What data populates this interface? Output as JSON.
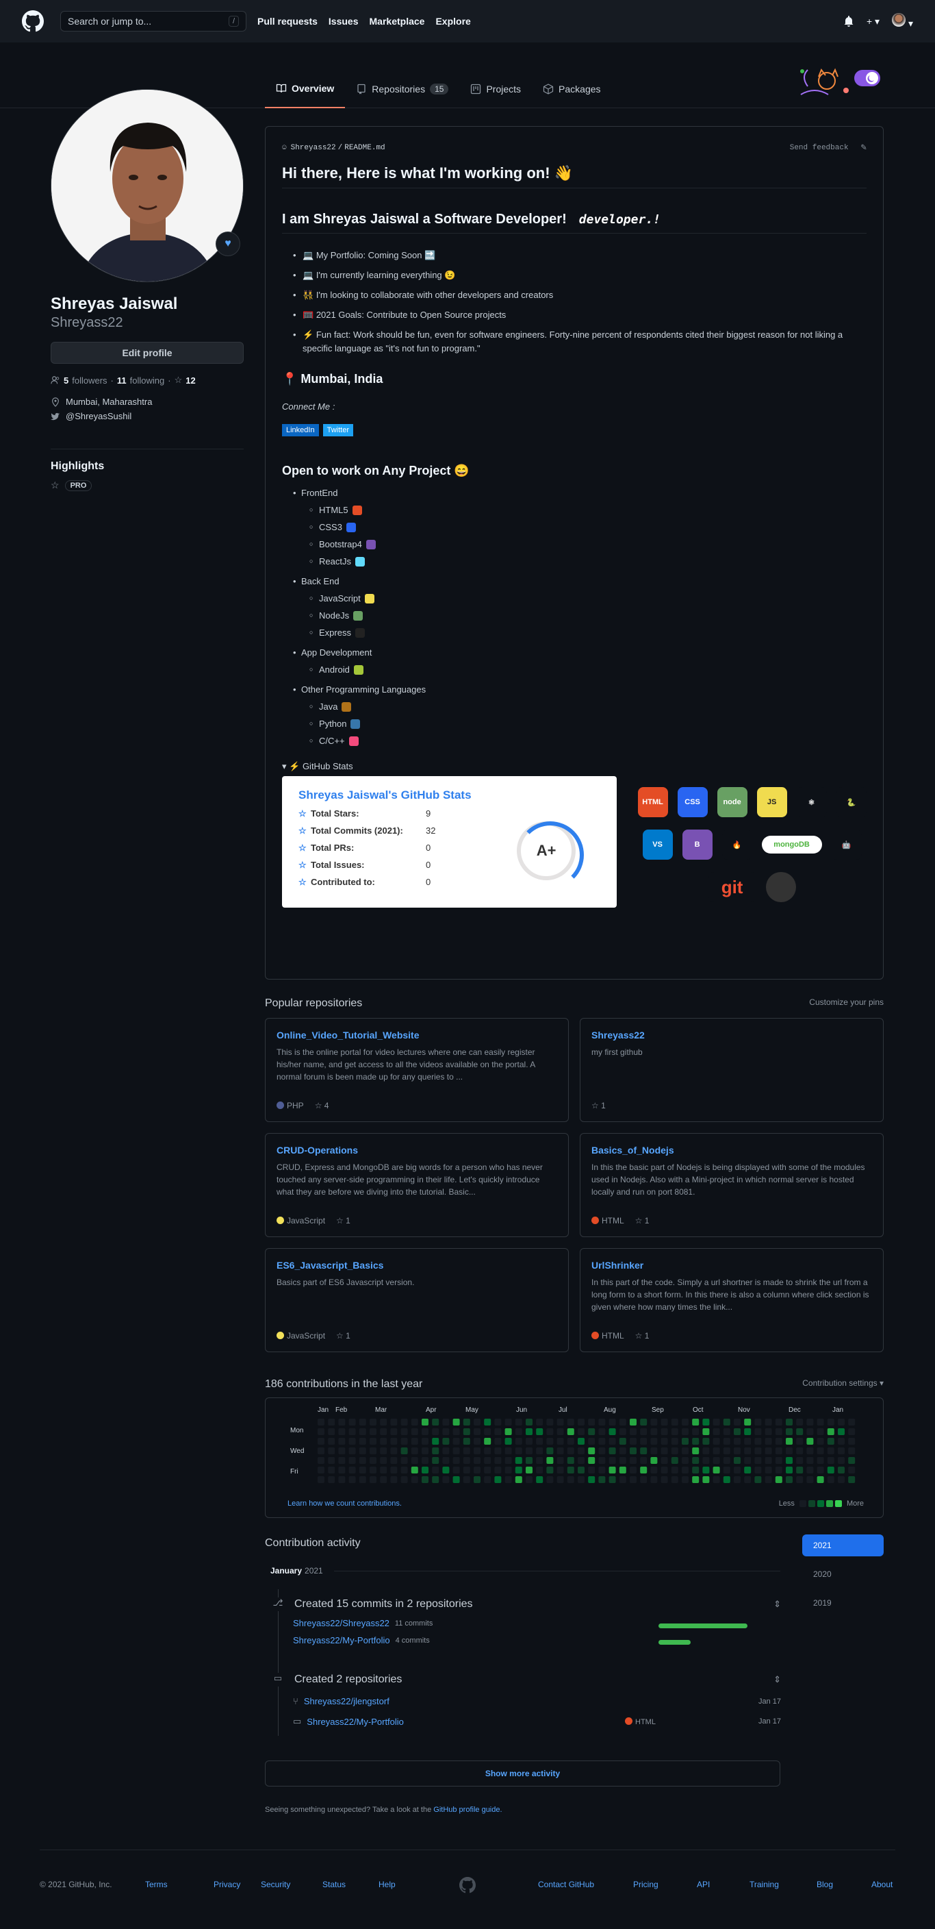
{
  "header": {
    "search_placeholder": "Search or jump to...",
    "search_shortcut": "/",
    "nav": [
      "Pull requests",
      "Issues",
      "Marketplace",
      "Explore"
    ]
  },
  "tabs": [
    {
      "label": "Overview",
      "icon": "book-icon"
    },
    {
      "label": "Repositories",
      "icon": "repo-icon",
      "count": "15"
    },
    {
      "label": "Projects",
      "icon": "project-icon"
    },
    {
      "label": "Packages",
      "icon": "package-icon"
    }
  ],
  "profile": {
    "name": "Shreyas Jaiswal",
    "login": "Shreyass22",
    "edit_label": "Edit profile",
    "followers_count": "5",
    "followers_label": "followers",
    "following_count": "11",
    "following_label": "following",
    "stars_count": "12",
    "location": "Mumbai, Maharashtra",
    "twitter": "@ShreyasSushil",
    "highlights_title": "Highlights",
    "pro_label": "PRO"
  },
  "readme": {
    "path_user": "Shreyass22",
    "path_sep": "/",
    "path_file": "README.md",
    "feedback": "Send feedback",
    "title": "Hi there, Here is what I'm working on! 👋",
    "subtitle": "I am Shreyas Jaiswal a Software Developer!",
    "dev_logo": "developer.!",
    "bullets": [
      "My Portfolio: Coming Soon",
      "I'm currently learning everything",
      "I'm looking to collaborate with other developers and creators",
      "2021 Goals: Contribute to Open Source projects",
      "Fun fact: Work should be fun, even for software engineers. Forty-nine percent of respondents cited their biggest     reason for not liking a specific language as \"it's not fun to program.\""
    ],
    "location_heading": "Mumbai, India",
    "connect": "Connect Me :",
    "badges": [
      "LinkedIn",
      "Twitter"
    ],
    "open_heading": "Open to work on Any Project 😄",
    "skills": [
      {
        "category": "FrontEnd",
        "items": [
          {
            "name": "HTML5",
            "color": "#e44d26"
          },
          {
            "name": "CSS3",
            "color": "#2965f1"
          },
          {
            "name": "Bootstrap4",
            "color": "#7952b3"
          },
          {
            "name": "ReactJs",
            "color": "#61dafb"
          }
        ]
      },
      {
        "category": "Back End",
        "items": [
          {
            "name": "JavaScript",
            "color": "#f0db4f"
          },
          {
            "name": "NodeJs",
            "color": "#68a063"
          },
          {
            "name": "Express",
            "color": "#222222"
          }
        ]
      },
      {
        "category": "App Development",
        "items": [
          {
            "name": "Android",
            "color": "#a4c639"
          }
        ]
      },
      {
        "category": "Other Programming Languages",
        "items": [
          {
            "name": "Java",
            "color": "#b07219"
          },
          {
            "name": "Python",
            "color": "#3776ab"
          },
          {
            "name": "C/C++",
            "color": "#f34b7d"
          }
        ]
      }
    ],
    "details_summary": "GitHub Stats",
    "stats": {
      "title": "Shreyas Jaiswal's GitHub Stats",
      "rows": [
        {
          "label": "Total Stars:",
          "value": "9"
        },
        {
          "label": "Total Commits (2021):",
          "value": "32"
        },
        {
          "label": "Total PRs:",
          "value": "0"
        },
        {
          "label": "Total Issues:",
          "value": "0"
        },
        {
          "label": "Contributed to:",
          "value": "0"
        }
      ],
      "grade": "A+"
    },
    "tech_icons": [
      {
        "name": "html5-icon",
        "label": "HTML",
        "color": "#e44d26"
      },
      {
        "name": "css3-icon",
        "label": "CSS",
        "color": "#2965f1"
      },
      {
        "name": "nodejs-icon",
        "label": "node",
        "color": "#68a063"
      },
      {
        "name": "javascript-icon",
        "label": "JS",
        "color": "#f0db4f"
      },
      {
        "name": "react-icon",
        "label": "⚛",
        "color": "#0d1117"
      },
      {
        "name": "python-icon",
        "label": "🐍",
        "color": "#0d1117"
      },
      {
        "name": "vscode-icon",
        "label": "VS",
        "color": "#007acc"
      },
      {
        "name": "bootstrap-icon",
        "label": "B",
        "color": "#7952b3"
      },
      {
        "name": "firebase-icon",
        "label": "🔥",
        "color": "#0d1117"
      },
      {
        "name": "mongodb-icon",
        "label": "mongoDB",
        "color": "#ffffff"
      },
      {
        "name": "android-icon",
        "label": "🤖",
        "color": "#0d1117"
      },
      {
        "name": "git-icon",
        "label": "git",
        "color": "#0d1117"
      },
      {
        "name": "github-icon",
        "label": "",
        "color": "#333333"
      }
    ]
  },
  "popular": {
    "title": "Popular repositories",
    "customize": "Customize your pins",
    "repos": [
      {
        "name": "Online_Video_Tutorial_Website",
        "desc": "This is the online portal for video lectures where one can easily register his/her name, and get access to all the videos available on the portal. A normal forum is been made up for any queries to ...",
        "lang": "PHP",
        "lang_color": "#4F5D95",
        "stars": "4"
      },
      {
        "name": "Shreyass22",
        "desc": "my first github",
        "lang": "",
        "lang_color": "",
        "stars": "1"
      },
      {
        "name": "CRUD-Operations",
        "desc": "CRUD, Express and MongoDB are big words for a person who has never touched any server-side programming in their life. Let's quickly introduce what they are before we diving into the tutorial. Basic...",
        "lang": "JavaScript",
        "lang_color": "#f1e05a",
        "stars": "1"
      },
      {
        "name": "Basics_of_Nodejs",
        "desc": "In this the basic part of Nodejs is being displayed with some of the modules used in Nodejs. Also with a Mini-project in which normal server is hosted locally and run on port 8081.",
        "lang": "HTML",
        "lang_color": "#e34c26",
        "stars": "1"
      },
      {
        "name": "ES6_Javascript_Basics",
        "desc": "Basics part of ES6 Javascript version.",
        "lang": "JavaScript",
        "lang_color": "#f1e05a",
        "stars": "1"
      },
      {
        "name": "UrlShrinker",
        "desc": "In this part of the code. Simply a url shortner is made to shrink the url from a long form to a short form. In this there is also a column where click section is given where how many times the link...",
        "lang": "HTML",
        "lang_color": "#e34c26",
        "stars": "1"
      }
    ]
  },
  "contributions": {
    "title": "186 contributions in the last year",
    "settings": "Contribution settings ▾",
    "months": [
      "Jan",
      "Feb",
      "Mar",
      "Apr",
      "May",
      "Jun",
      "Jul",
      "Aug",
      "Sep",
      "Oct",
      "Nov",
      "Dec",
      "Jan"
    ],
    "days": [
      "Mon",
      "Wed",
      "Fri"
    ],
    "learn": "Learn how we count contributions.",
    "less": "Less",
    "more": "More",
    "colors": [
      "#161b22",
      "#0e4429",
      "#006d32",
      "#26a641",
      "#39d353"
    ]
  },
  "activity": {
    "title": "Contribution activity",
    "years": [
      "2021",
      "2020",
      "2019"
    ],
    "month": "January",
    "year": "2021",
    "commits": {
      "title": "Created 15 commits in 2 repositories",
      "rows": [
        {
          "repo": "Shreyass22/Shreyass22",
          "count": "11 commits",
          "fraction": 1.0
        },
        {
          "repo": "Shreyass22/My-Portfolio",
          "count": "4 commits",
          "fraction": 0.36
        }
      ]
    },
    "repos": {
      "title": "Created 2 repositories",
      "rows": [
        {
          "repo": "Shreyass22/jlengstorf",
          "lang": "",
          "date": "Jan 17",
          "icon": "fork-icon"
        },
        {
          "repo": "Shreyass22/My-Portfolio",
          "lang": "HTML",
          "date": "Jan 17",
          "icon": "repo-icon"
        }
      ]
    },
    "show_more": "Show more activity",
    "unexpected": "Seeing something unexpected? Take a look at the",
    "guide": "GitHub profile guide."
  },
  "footer": {
    "copyright": "© 2021 GitHub, Inc.",
    "links_left": [
      "Terms",
      "Privacy",
      "Security",
      "Status",
      "Help"
    ],
    "links_right": [
      "Contact GitHub",
      "Pricing",
      "API",
      "Training",
      "Blog",
      "About"
    ]
  }
}
